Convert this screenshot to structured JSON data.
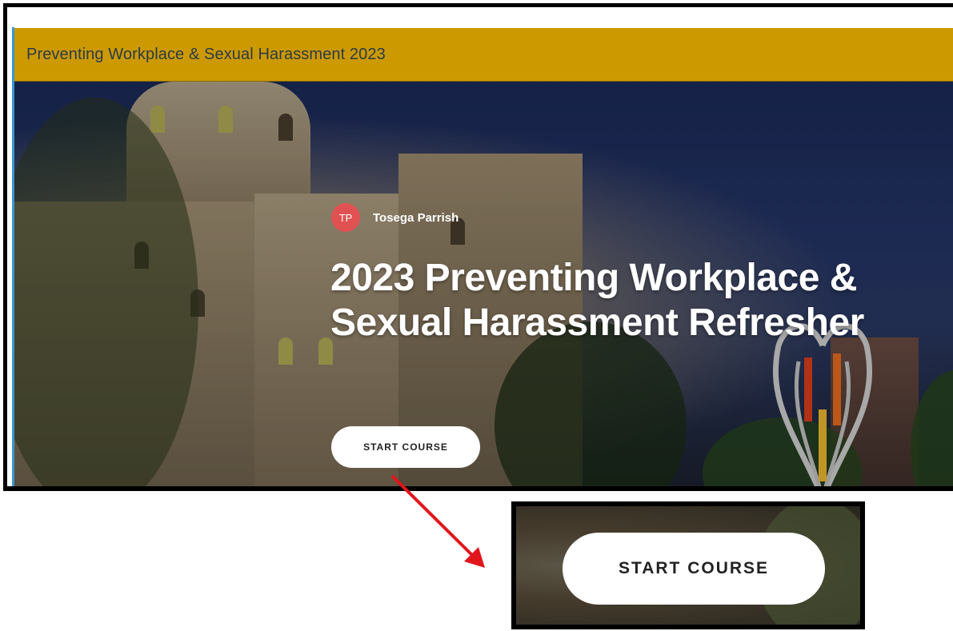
{
  "header": {
    "course_title": "Preventing Workplace & Sexual Harassment 2023"
  },
  "hero": {
    "author_initials": "TP",
    "author_name": "Tosega Parrish",
    "heading": "2023 Preventing Workplace & Sexual Harassment Refresher",
    "start_button_label": "START COURSE"
  },
  "callout": {
    "zoomed_button_label": "START COURSE",
    "arrow_color": "#e0161b"
  },
  "colors": {
    "title_bar": "#cc9a00",
    "avatar": "#e05252",
    "accent_line": "#3a96d0"
  }
}
